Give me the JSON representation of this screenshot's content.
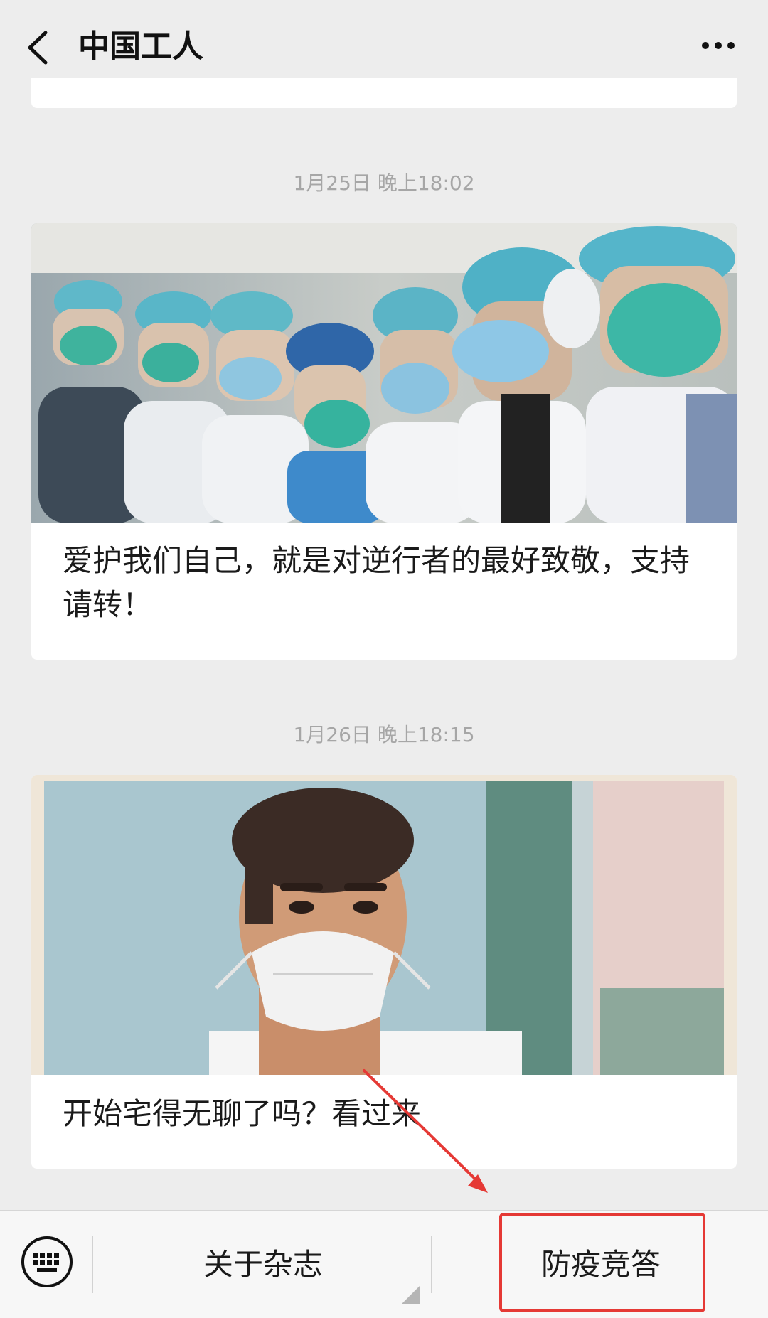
{
  "header": {
    "title": "中国工人"
  },
  "feed": [
    {
      "timestamp": "1月25日 晚上18:02",
      "title": "爱护我们自己，就是对逆行者的最好致敬，支持请转！"
    },
    {
      "timestamp": "1月26日 晚上18:15",
      "title": "开始宅得无聊了吗？看过来"
    }
  ],
  "bottom_menu": {
    "items": [
      "关于杂志",
      "防疫竞答"
    ]
  },
  "colors": {
    "background": "#ededed",
    "highlight": "#e53935",
    "timestamp": "#a6a6a6"
  },
  "icons": {
    "back": "chevron-left-icon",
    "more": "more-icon",
    "keyboard": "keyboard-icon"
  }
}
